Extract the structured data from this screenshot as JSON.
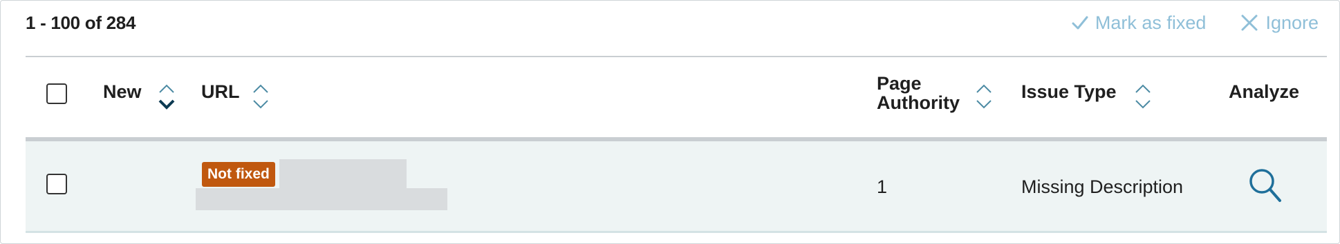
{
  "pagination": {
    "range": "1 - 100 of 284"
  },
  "toolbar": {
    "mark_fixed_label": "Mark as fixed",
    "ignore_label": "Ignore",
    "action_color": "#8fbfd8"
  },
  "table": {
    "columns": {
      "new": "New",
      "url": "URL",
      "page_authority_line1": "Page",
      "page_authority_line2": "Authority",
      "issue_type": "Issue Type",
      "analyze": "Analyze"
    },
    "sorted_column": "New",
    "rows": [
      {
        "status_badge": "Not fixed",
        "status_color": "#c0580f",
        "url": "",
        "page_authority": "1",
        "issue_type": "Missing Description",
        "analyze_icon": "magnifier-icon"
      }
    ]
  }
}
